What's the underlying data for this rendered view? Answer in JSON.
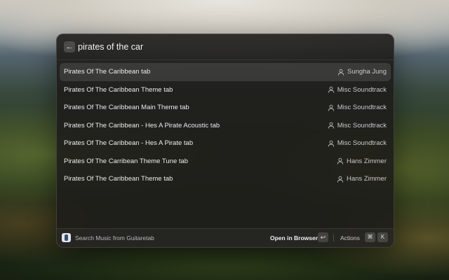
{
  "search": {
    "back_icon": "arrow-left-icon",
    "query": "pirates of the car"
  },
  "results": [
    {
      "title": "Pirates Of The Caribbean tab",
      "artist": "Sungha Jung",
      "selected": true
    },
    {
      "title": "Pirates Of The Caribbean Theme tab",
      "artist": "Misc Soundtrack"
    },
    {
      "title": "Pirates Of The Caribbean Main Theme tab",
      "artist": "Misc Soundtrack"
    },
    {
      "title": "Pirates Of The Caribbean - Hes A Pirate Acoustic tab",
      "artist": "Misc Soundtrack"
    },
    {
      "title": "Pirates Of The Caribbean - Hes A Pirate tab",
      "artist": "Misc Soundtrack"
    },
    {
      "title": "Pirates Of The Carribean Theme Tune tab",
      "artist": "Hans Zimmer"
    },
    {
      "title": "Pirates Of The Caribbean Theme tab",
      "artist": "Hans Zimmer"
    }
  ],
  "footer": {
    "command_label": "Search Music from Guitaretab",
    "primary_action": "Open in Browser",
    "enter_key": "↩",
    "actions_label": "Actions",
    "cmd_key": "⌘",
    "k_key": "K"
  },
  "colors": {
    "panel_bg": "#1e1d1b",
    "selected_row": "#3a3937",
    "text": "#ececec"
  }
}
